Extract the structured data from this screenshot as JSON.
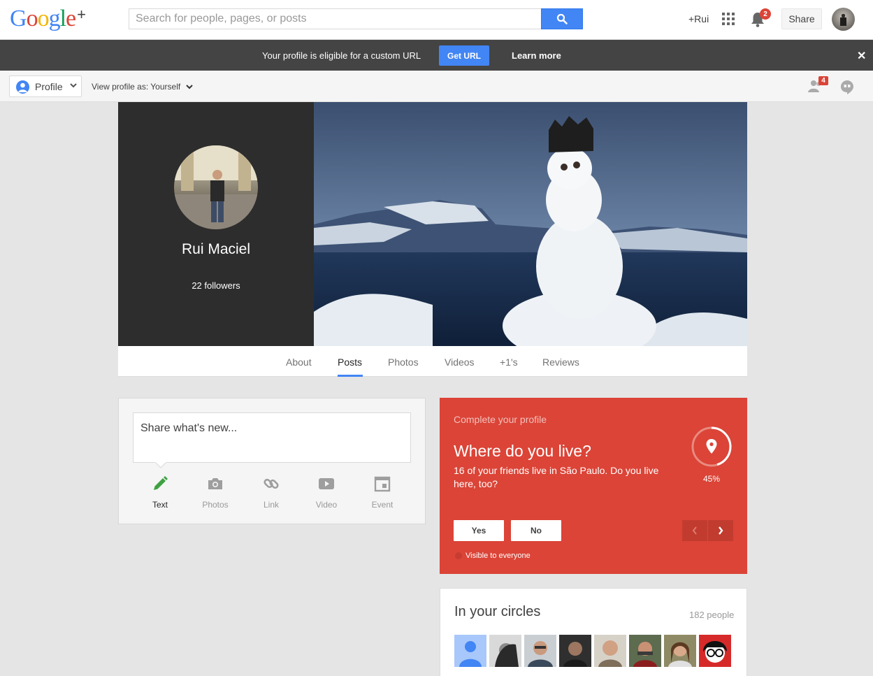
{
  "topbar": {
    "logo_letters": [
      {
        "ch": "G",
        "color": "#4285f4"
      },
      {
        "ch": "o",
        "color": "#db4437"
      },
      {
        "ch": "o",
        "color": "#f4b400"
      },
      {
        "ch": "g",
        "color": "#4285f4"
      },
      {
        "ch": "l",
        "color": "#0f9d58"
      },
      {
        "ch": "e",
        "color": "#db4437"
      },
      {
        "ch": "+",
        "color": "#404040"
      }
    ],
    "search_placeholder": "Search for people, pages, or posts",
    "user_link": "+Rui",
    "notification_count": "2",
    "share_label": "Share"
  },
  "notice": {
    "text": "Your profile is eligible for a custom URL",
    "get_url": "Get URL",
    "learn_more": "Learn more",
    "close_glyph": "✕"
  },
  "subbar": {
    "profile_label": "Profile",
    "view_as": "View profile as: Yourself",
    "people_badge": "4"
  },
  "profile": {
    "name": "Rui Maciel",
    "followers": "22 followers"
  },
  "tabs": [
    "About",
    "Posts",
    "Photos",
    "Videos",
    "+1's",
    "Reviews"
  ],
  "active_tab": "Posts",
  "share_card": {
    "placeholder": "Share what's new...",
    "options": [
      {
        "label": "Text",
        "icon": "pencil-icon",
        "active": true
      },
      {
        "label": "Photos",
        "icon": "camera-icon",
        "active": false
      },
      {
        "label": "Link",
        "icon": "link-icon",
        "active": false
      },
      {
        "label": "Video",
        "icon": "video-icon",
        "active": false
      },
      {
        "label": "Event",
        "icon": "event-icon",
        "active": false
      }
    ]
  },
  "complete_profile": {
    "kicker": "Complete your profile",
    "title": "Where do you live?",
    "body": "16 of your friends live in São Paulo. Do you live here, too?",
    "progress_label": "45%",
    "progress": 0.45,
    "yes": "Yes",
    "no": "No",
    "visibility": "Visible to everyone",
    "color": "#db4437"
  },
  "circles": {
    "title": "In your circles",
    "count": "182 people"
  },
  "colors": {
    "accent_blue": "#4285f4",
    "red": "#db4437",
    "dark_bar": "#444444"
  }
}
